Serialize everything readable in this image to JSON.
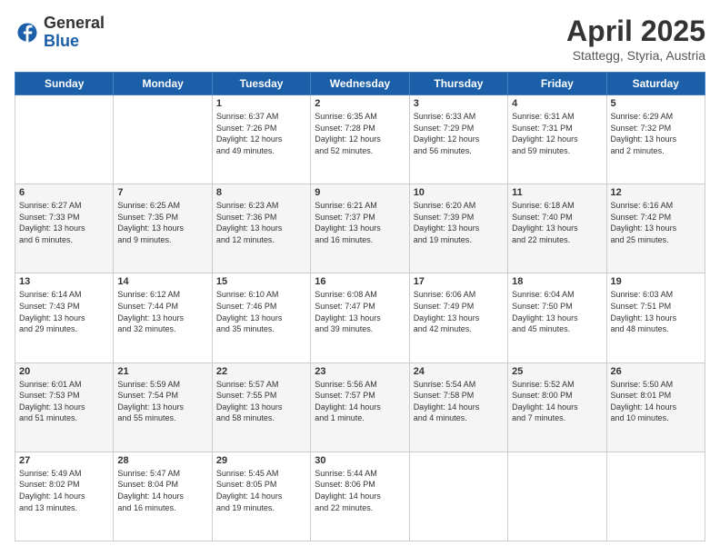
{
  "logo": {
    "general": "General",
    "blue": "Blue"
  },
  "title": "April 2025",
  "subtitle": "Stattegg, Styria, Austria",
  "headers": [
    "Sunday",
    "Monday",
    "Tuesday",
    "Wednesday",
    "Thursday",
    "Friday",
    "Saturday"
  ],
  "weeks": [
    [
      {
        "day": "",
        "info": ""
      },
      {
        "day": "",
        "info": ""
      },
      {
        "day": "1",
        "info": "Sunrise: 6:37 AM\nSunset: 7:26 PM\nDaylight: 12 hours\nand 49 minutes."
      },
      {
        "day": "2",
        "info": "Sunrise: 6:35 AM\nSunset: 7:28 PM\nDaylight: 12 hours\nand 52 minutes."
      },
      {
        "day": "3",
        "info": "Sunrise: 6:33 AM\nSunset: 7:29 PM\nDaylight: 12 hours\nand 56 minutes."
      },
      {
        "day": "4",
        "info": "Sunrise: 6:31 AM\nSunset: 7:31 PM\nDaylight: 12 hours\nand 59 minutes."
      },
      {
        "day": "5",
        "info": "Sunrise: 6:29 AM\nSunset: 7:32 PM\nDaylight: 13 hours\nand 2 minutes."
      }
    ],
    [
      {
        "day": "6",
        "info": "Sunrise: 6:27 AM\nSunset: 7:33 PM\nDaylight: 13 hours\nand 6 minutes."
      },
      {
        "day": "7",
        "info": "Sunrise: 6:25 AM\nSunset: 7:35 PM\nDaylight: 13 hours\nand 9 minutes."
      },
      {
        "day": "8",
        "info": "Sunrise: 6:23 AM\nSunset: 7:36 PM\nDaylight: 13 hours\nand 12 minutes."
      },
      {
        "day": "9",
        "info": "Sunrise: 6:21 AM\nSunset: 7:37 PM\nDaylight: 13 hours\nand 16 minutes."
      },
      {
        "day": "10",
        "info": "Sunrise: 6:20 AM\nSunset: 7:39 PM\nDaylight: 13 hours\nand 19 minutes."
      },
      {
        "day": "11",
        "info": "Sunrise: 6:18 AM\nSunset: 7:40 PM\nDaylight: 13 hours\nand 22 minutes."
      },
      {
        "day": "12",
        "info": "Sunrise: 6:16 AM\nSunset: 7:42 PM\nDaylight: 13 hours\nand 25 minutes."
      }
    ],
    [
      {
        "day": "13",
        "info": "Sunrise: 6:14 AM\nSunset: 7:43 PM\nDaylight: 13 hours\nand 29 minutes."
      },
      {
        "day": "14",
        "info": "Sunrise: 6:12 AM\nSunset: 7:44 PM\nDaylight: 13 hours\nand 32 minutes."
      },
      {
        "day": "15",
        "info": "Sunrise: 6:10 AM\nSunset: 7:46 PM\nDaylight: 13 hours\nand 35 minutes."
      },
      {
        "day": "16",
        "info": "Sunrise: 6:08 AM\nSunset: 7:47 PM\nDaylight: 13 hours\nand 39 minutes."
      },
      {
        "day": "17",
        "info": "Sunrise: 6:06 AM\nSunset: 7:49 PM\nDaylight: 13 hours\nand 42 minutes."
      },
      {
        "day": "18",
        "info": "Sunrise: 6:04 AM\nSunset: 7:50 PM\nDaylight: 13 hours\nand 45 minutes."
      },
      {
        "day": "19",
        "info": "Sunrise: 6:03 AM\nSunset: 7:51 PM\nDaylight: 13 hours\nand 48 minutes."
      }
    ],
    [
      {
        "day": "20",
        "info": "Sunrise: 6:01 AM\nSunset: 7:53 PM\nDaylight: 13 hours\nand 51 minutes."
      },
      {
        "day": "21",
        "info": "Sunrise: 5:59 AM\nSunset: 7:54 PM\nDaylight: 13 hours\nand 55 minutes."
      },
      {
        "day": "22",
        "info": "Sunrise: 5:57 AM\nSunset: 7:55 PM\nDaylight: 13 hours\nand 58 minutes."
      },
      {
        "day": "23",
        "info": "Sunrise: 5:56 AM\nSunset: 7:57 PM\nDaylight: 14 hours\nand 1 minute."
      },
      {
        "day": "24",
        "info": "Sunrise: 5:54 AM\nSunset: 7:58 PM\nDaylight: 14 hours\nand 4 minutes."
      },
      {
        "day": "25",
        "info": "Sunrise: 5:52 AM\nSunset: 8:00 PM\nDaylight: 14 hours\nand 7 minutes."
      },
      {
        "day": "26",
        "info": "Sunrise: 5:50 AM\nSunset: 8:01 PM\nDaylight: 14 hours\nand 10 minutes."
      }
    ],
    [
      {
        "day": "27",
        "info": "Sunrise: 5:49 AM\nSunset: 8:02 PM\nDaylight: 14 hours\nand 13 minutes."
      },
      {
        "day": "28",
        "info": "Sunrise: 5:47 AM\nSunset: 8:04 PM\nDaylight: 14 hours\nand 16 minutes."
      },
      {
        "day": "29",
        "info": "Sunrise: 5:45 AM\nSunset: 8:05 PM\nDaylight: 14 hours\nand 19 minutes."
      },
      {
        "day": "30",
        "info": "Sunrise: 5:44 AM\nSunset: 8:06 PM\nDaylight: 14 hours\nand 22 minutes."
      },
      {
        "day": "",
        "info": ""
      },
      {
        "day": "",
        "info": ""
      },
      {
        "day": "",
        "info": ""
      }
    ]
  ]
}
